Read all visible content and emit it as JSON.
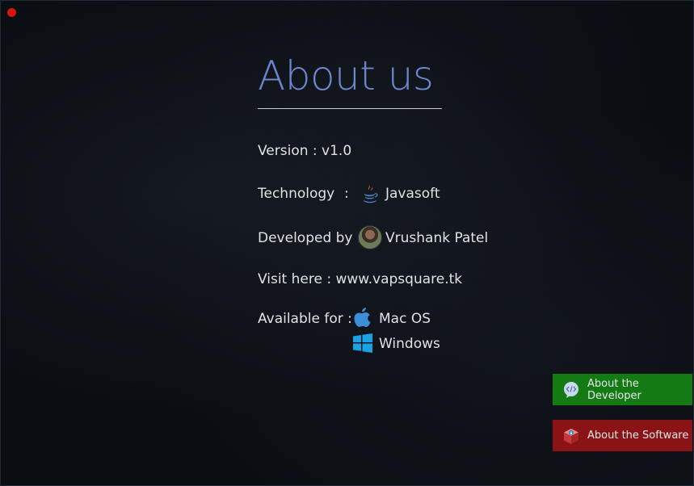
{
  "window": {
    "close_color": "#d8140f"
  },
  "title": "About us",
  "rows": {
    "version": "Version : v1.0",
    "technology_label": "Technology",
    "technology_sep": ":",
    "technology_value": "Javasoft",
    "developed_label": "Developed by :",
    "developed_value": "Vrushank Patel",
    "visit": "Visit here : www.vapsquare.tk",
    "available_label": "Available for :",
    "platforms": [
      "Mac OS",
      "Windows"
    ]
  },
  "buttons": {
    "developer": "About the Developer",
    "software": "About the Software"
  },
  "colors": {
    "title": "#6d86d0",
    "developer_button": "#137a14",
    "software_button": "#8a1316"
  },
  "icons": [
    "java-icon",
    "avatar",
    "apple-icon",
    "windows-icon",
    "code-bubble-icon",
    "package-icon"
  ]
}
